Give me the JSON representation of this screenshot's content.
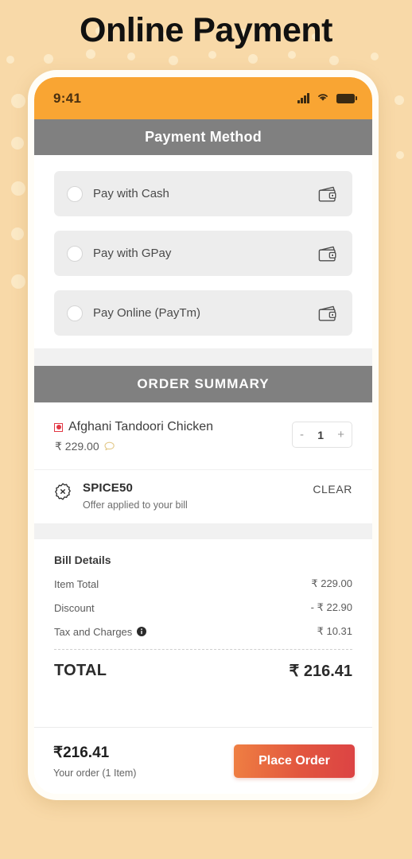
{
  "page": {
    "title": "Online Payment"
  },
  "status_bar": {
    "time": "9:41",
    "icons": [
      "signal-icon",
      "wifi-icon",
      "battery-icon"
    ]
  },
  "payment_section": {
    "header": "Payment Method",
    "options": [
      {
        "label": "Pay with Cash",
        "selected": false,
        "icon": "wallet-icon"
      },
      {
        "label": "Pay with GPay",
        "selected": false,
        "icon": "wallet-icon"
      },
      {
        "label": "Pay Online (PayTm)",
        "selected": false,
        "icon": "wallet-icon"
      }
    ]
  },
  "order_summary": {
    "header": "ORDER SUMMARY",
    "item": {
      "name": "Afghani Tandoori Chicken",
      "price": "₹ 229.00",
      "diet_mark": "nonveg-icon",
      "note_icon": "chat-bubble-icon",
      "quantity": "1",
      "decrement_label": "-",
      "increment_label": "+"
    },
    "coupon": {
      "icon": "coupon-badge-icon",
      "code": "SPICE50",
      "description": "Offer applied to your bill",
      "clear_label": "CLEAR"
    },
    "bill": {
      "title": "Bill Details",
      "rows": [
        {
          "label": "Item Total",
          "value": "₹ 229.00",
          "info": false
        },
        {
          "label": "Discount",
          "value": "- ₹ 22.90",
          "info": false
        },
        {
          "label": "Tax and Charges",
          "value": "₹ 10.31",
          "info": true
        }
      ],
      "total_label": "TOTAL",
      "total_value": "₹ 216.41"
    }
  },
  "bottom_bar": {
    "total": "₹216.41",
    "subtitle": "Your order (1 Item)",
    "place_order_label": "Place Order"
  },
  "colors": {
    "background": "#f8d9a8",
    "status_bar": "#f9a533",
    "section_bar": "#808080",
    "accent_button_start": "#ef7f42",
    "accent_button_end": "#dc4344",
    "nonveg": "#e23744"
  }
}
